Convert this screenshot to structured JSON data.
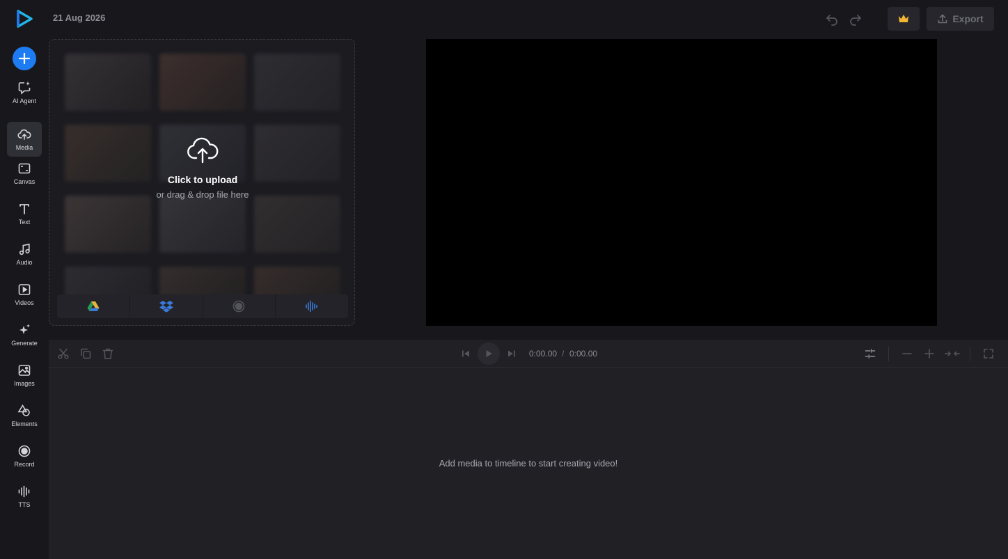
{
  "header": {
    "date": "21 Aug 2026",
    "export_label": "Export"
  },
  "sidebar": {
    "items": [
      {
        "label": "AI Agent",
        "icon": "ai-agent-icon"
      },
      {
        "label": "Media",
        "icon": "cloud-upload-icon"
      },
      {
        "label": "Canvas",
        "icon": "canvas-icon"
      },
      {
        "label": "Text",
        "icon": "text-icon"
      },
      {
        "label": "Audio",
        "icon": "music-note-icon"
      },
      {
        "label": "Videos",
        "icon": "video-icon"
      },
      {
        "label": "Generate",
        "icon": "sparkle-icon"
      },
      {
        "label": "Images",
        "icon": "image-icon"
      },
      {
        "label": "Elements",
        "icon": "shapes-icon"
      },
      {
        "label": "Record",
        "icon": "record-icon"
      },
      {
        "label": "TTS",
        "icon": "waveform-icon"
      }
    ],
    "active": "Media"
  },
  "upload": {
    "title": "Click to upload",
    "subtitle": "or drag & drop file here",
    "sources": [
      "google-drive-icon",
      "dropbox-icon",
      "record-icon",
      "waveform-icon"
    ]
  },
  "timeline": {
    "current_time": "0:00.00",
    "separator": "/",
    "total_time": "0:00.00",
    "empty_message": "Add media to timeline to start creating video!"
  },
  "colors": {
    "accent": "#1e7cf2",
    "crown": "#f2b632",
    "background": "#18181c",
    "panel": "#202025"
  }
}
